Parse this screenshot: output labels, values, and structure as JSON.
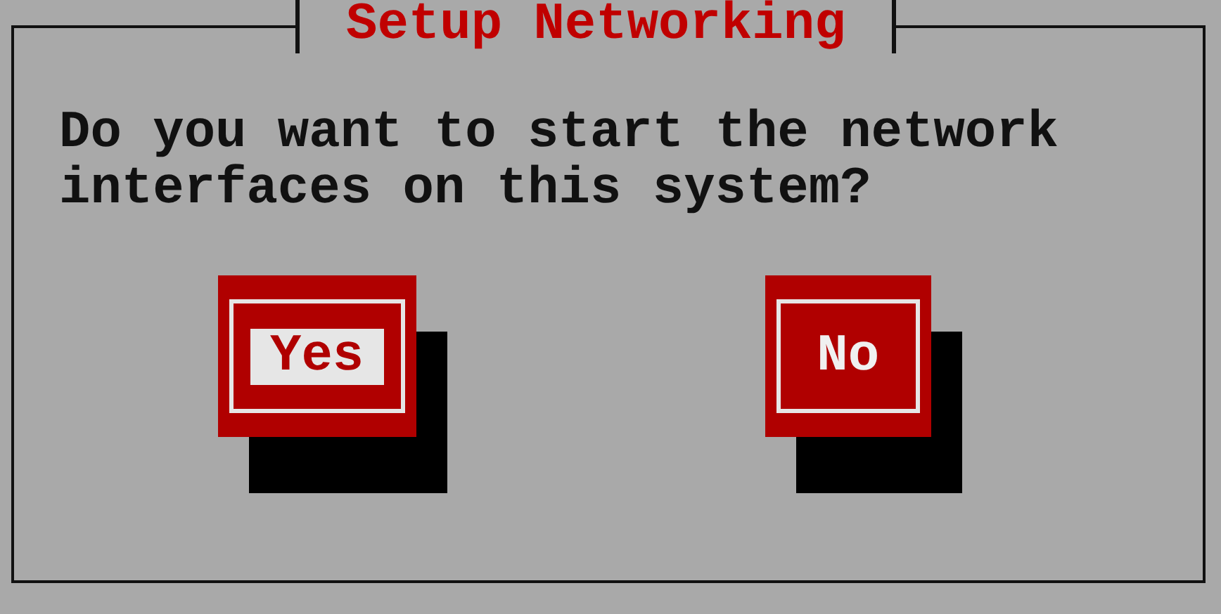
{
  "dialog": {
    "title": "Setup Networking",
    "message": "Do you want to start the network interfaces on this system?"
  },
  "buttons": [
    {
      "label": "Yes",
      "selected": true
    },
    {
      "label": "No",
      "selected": false
    }
  ]
}
